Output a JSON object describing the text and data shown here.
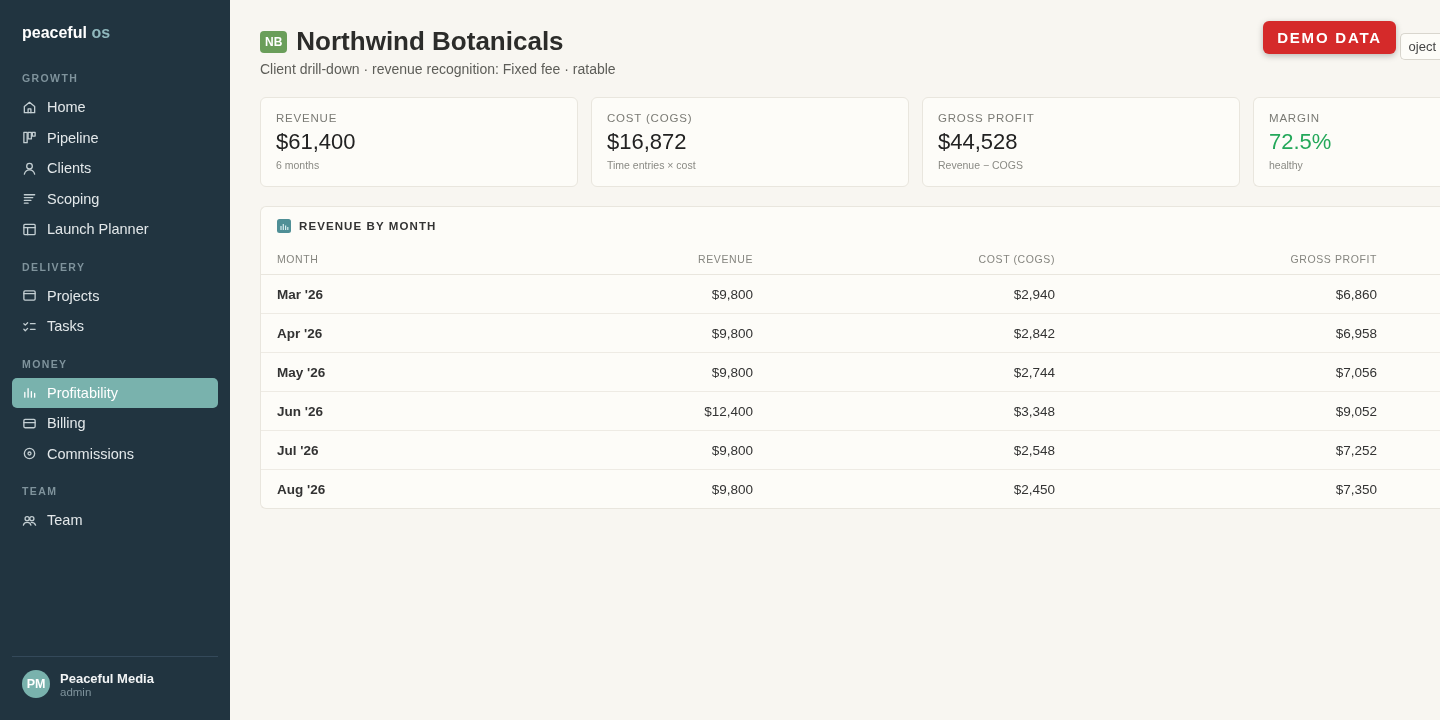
{
  "sidebar": {
    "logo": {
      "primary": "peaceful",
      "secondary": "os"
    },
    "sections": [
      {
        "title": "GROWTH",
        "items": [
          {
            "label": "Home",
            "selected": false
          },
          {
            "label": "Pipeline",
            "selected": false
          },
          {
            "label": "Clients",
            "selected": false
          },
          {
            "label": "Scoping",
            "selected": false
          },
          {
            "label": "Launch Planner",
            "selected": false
          }
        ]
      },
      {
        "title": "DELIVERY",
        "items": [
          {
            "label": "Projects",
            "selected": false
          },
          {
            "label": "Tasks",
            "selected": false
          }
        ]
      },
      {
        "title": "MONEY",
        "items": [
          {
            "label": "Profitability",
            "selected": true
          },
          {
            "label": "Billing",
            "selected": false
          },
          {
            "label": "Commissions",
            "selected": false
          }
        ]
      },
      {
        "title": "TEAM",
        "items": [
          {
            "label": "Team",
            "selected": false
          }
        ]
      }
    ],
    "user": {
      "initials": "PM",
      "name": "Peaceful Media",
      "role": "admin"
    }
  },
  "header": {
    "badge": "NB",
    "title": "Northwind Botanicals",
    "subtitle": "Client drill-down · revenue recognition: Fixed fee · ratable",
    "button": "oject"
  },
  "demo_badge": "DEMO DATA",
  "kpis": [
    {
      "label": "REVENUE",
      "value": "$61,400",
      "note": "6 months",
      "color": "#222222"
    },
    {
      "label": "COST (COGS)",
      "value": "$16,872",
      "note": "Time entries × cost",
      "color": "#222222"
    },
    {
      "label": "GROSS PROFIT",
      "value": "$44,528",
      "note": "Revenue − COGS",
      "color": "#222222"
    },
    {
      "label": "MARGIN",
      "value": "72.5%",
      "note": "healthy",
      "color": "#24a85a"
    }
  ],
  "table": {
    "title": "REVENUE BY MONTH",
    "columns": [
      "MONTH",
      "REVENUE",
      "COST (COGS)",
      "GROSS PROFIT"
    ],
    "rows": [
      [
        "Mar '26",
        "$9,800",
        "$2,940",
        "$6,860"
      ],
      [
        "Apr '26",
        "$9,800",
        "$2,842",
        "$6,958"
      ],
      [
        "May '26",
        "$9,800",
        "$2,744",
        "$7,056"
      ],
      [
        "Jun '26",
        "$12,400",
        "$3,348",
        "$9,052"
      ],
      [
        "Jul '26",
        "$9,800",
        "$2,548",
        "$7,252"
      ],
      [
        "Aug '26",
        "$9,800",
        "$2,450",
        "$7,350"
      ]
    ]
  }
}
